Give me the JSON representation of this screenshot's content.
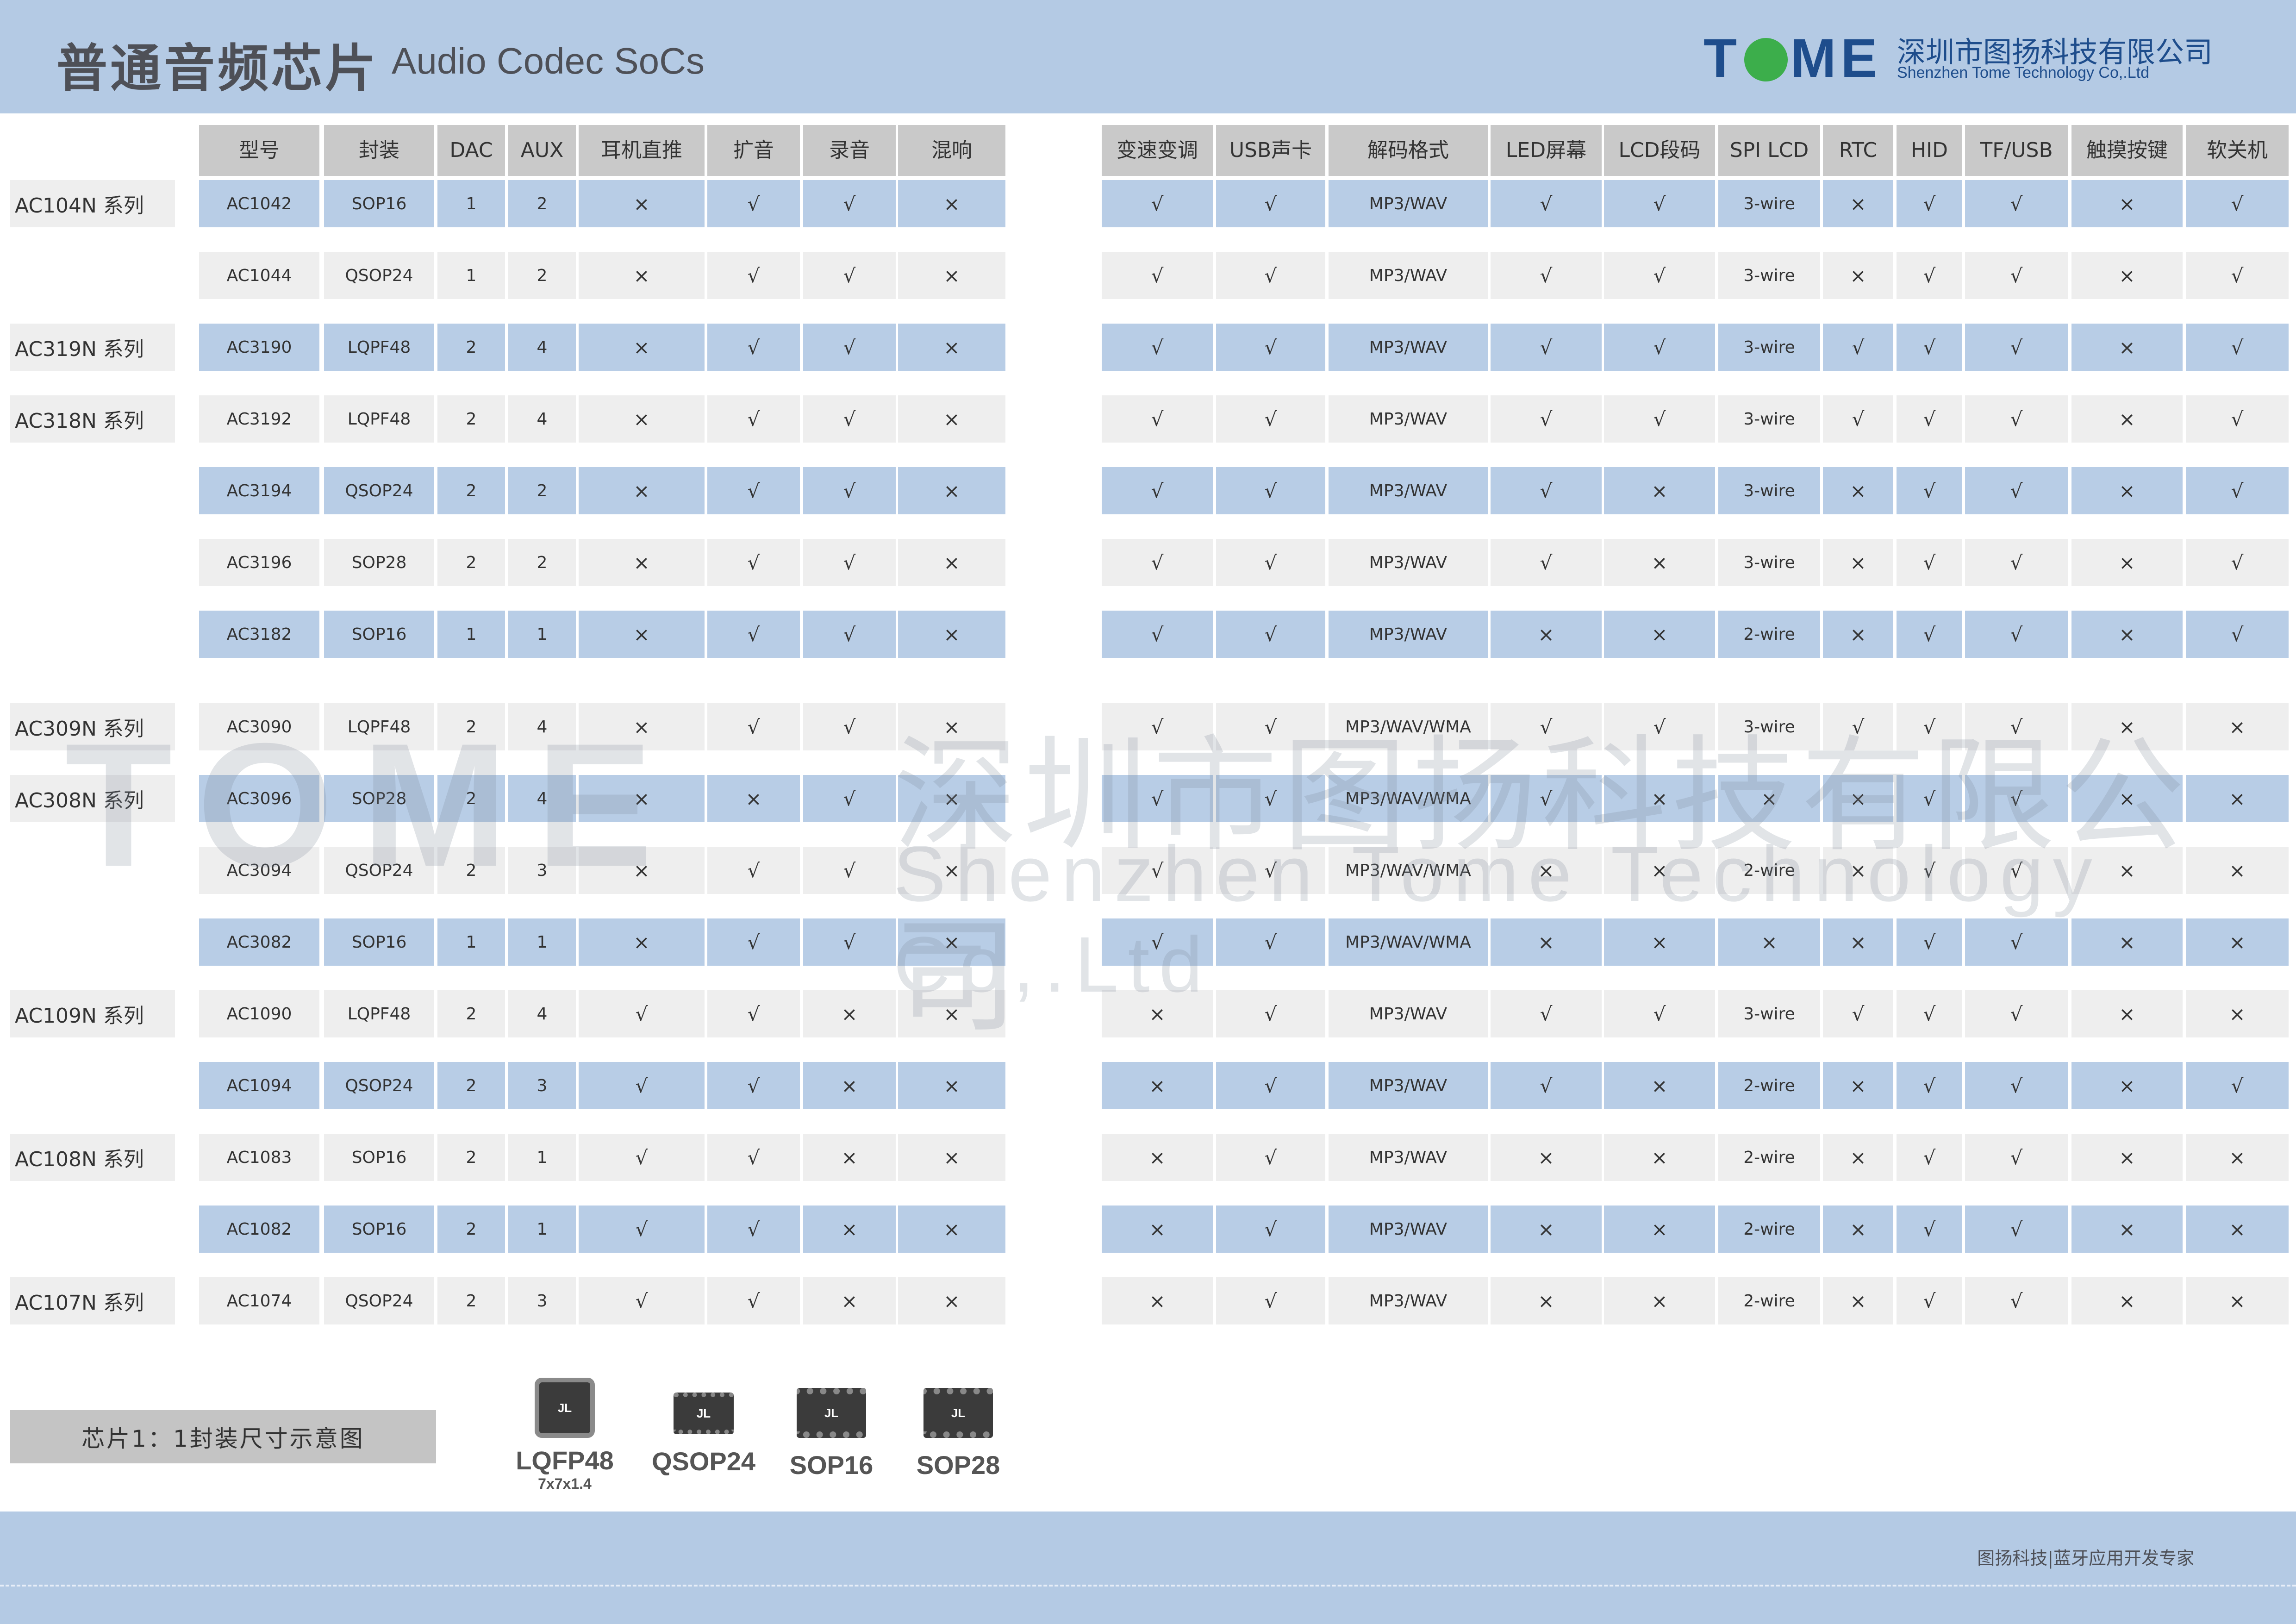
{
  "header": {
    "title_cn": "普通音频芯片",
    "title_en": "Audio Codec SoCs",
    "logo_left": "T",
    "logo_right": "ME",
    "company_cn": "深圳市图扬科技有限公司",
    "company_en": "Shenzhen Tome Technology Co,.Ltd"
  },
  "columns": [
    "型号",
    "封装",
    "DAC",
    "AUX",
    "耳机直推",
    "扩音",
    "录音",
    "混响",
    "变速变调",
    "USB声卡",
    "解码格式",
    "LED屏幕",
    "LCD段码",
    "SPI LCD",
    "RTC",
    "HID",
    "TF/USB",
    "触摸按键",
    "软关机"
  ],
  "series": [
    {
      "label": "AC104N 系列",
      "row": 0
    },
    {
      "label": "AC319N 系列",
      "row": 2
    },
    {
      "label": "AC318N 系列",
      "row": 3
    },
    {
      "label": "AC309N 系列",
      "row": 7
    },
    {
      "label": "AC308N 系列",
      "row": 8
    },
    {
      "label": "AC109N 系列",
      "row": 11
    },
    {
      "label": "AC108N 系列",
      "row": 13
    },
    {
      "label": "AC107N 系列",
      "row": 15
    }
  ],
  "rows": [
    [
      "AC1042",
      "SOP16",
      "1",
      "2",
      "×",
      "√",
      "√",
      "×",
      "√",
      "√",
      "MP3/WAV",
      "√",
      "√",
      "3-wire",
      "×",
      "√",
      "√",
      "×",
      "√"
    ],
    [
      "AC1044",
      "QSOP24",
      "1",
      "2",
      "×",
      "√",
      "√",
      "×",
      "√",
      "√",
      "MP3/WAV",
      "√",
      "√",
      "3-wire",
      "×",
      "√",
      "√",
      "×",
      "√"
    ],
    [
      "AC3190",
      "LQPF48",
      "2",
      "4",
      "×",
      "√",
      "√",
      "×",
      "√",
      "√",
      "MP3/WAV",
      "√",
      "√",
      "3-wire",
      "√",
      "√",
      "√",
      "×",
      "√"
    ],
    [
      "AC3192",
      "LQPF48",
      "2",
      "4",
      "×",
      "√",
      "√",
      "×",
      "√",
      "√",
      "MP3/WAV",
      "√",
      "√",
      "3-wire",
      "√",
      "√",
      "√",
      "×",
      "√"
    ],
    [
      "AC3194",
      "QSOP24",
      "2",
      "2",
      "×",
      "√",
      "√",
      "×",
      "√",
      "√",
      "MP3/WAV",
      "√",
      "×",
      "3-wire",
      "×",
      "√",
      "√",
      "×",
      "√"
    ],
    [
      "AC3196",
      "SOP28",
      "2",
      "2",
      "×",
      "√",
      "√",
      "×",
      "√",
      "√",
      "MP3/WAV",
      "√",
      "×",
      "3-wire",
      "×",
      "√",
      "√",
      "×",
      "√"
    ],
    [
      "AC3182",
      "SOP16",
      "1",
      "1",
      "×",
      "√",
      "√",
      "×",
      "√",
      "√",
      "MP3/WAV",
      "×",
      "×",
      "2-wire",
      "×",
      "√",
      "√",
      "×",
      "√"
    ],
    [
      "AC3090",
      "LQPF48",
      "2",
      "4",
      "×",
      "√",
      "√",
      "×",
      "√",
      "√",
      "MP3/WAV/WMA",
      "√",
      "√",
      "3-wire",
      "√",
      "√",
      "√",
      "×",
      "×"
    ],
    [
      "AC3096",
      "SOP28",
      "2",
      "4",
      "×",
      "×",
      "√",
      "×",
      "√",
      "√",
      "MP3/WAV/WMA",
      "√",
      "×",
      "×",
      "×",
      "√",
      "√",
      "×",
      "×"
    ],
    [
      "AC3094",
      "QSOP24",
      "2",
      "3",
      "×",
      "√",
      "√",
      "×",
      "√",
      "√",
      "MP3/WAV/WMA",
      "×",
      "×",
      "2-wire",
      "×",
      "√",
      "√",
      "×",
      "×"
    ],
    [
      "AC3082",
      "SOP16",
      "1",
      "1",
      "×",
      "√",
      "√",
      "×",
      "√",
      "√",
      "MP3/WAV/WMA",
      "×",
      "×",
      "×",
      "×",
      "√",
      "√",
      "×",
      "×"
    ],
    [
      "AC1090",
      "LQPF48",
      "2",
      "4",
      "√",
      "√",
      "×",
      "×",
      "×",
      "√",
      "MP3/WAV",
      "√",
      "√",
      "3-wire",
      "√",
      "√",
      "√",
      "×",
      "×"
    ],
    [
      "AC1094",
      "QSOP24",
      "2",
      "3",
      "√",
      "√",
      "×",
      "×",
      "×",
      "√",
      "MP3/WAV",
      "√",
      "×",
      "2-wire",
      "×",
      "√",
      "√",
      "×",
      "√"
    ],
    [
      "AC1083",
      "SOP16",
      "2",
      "1",
      "√",
      "√",
      "×",
      "×",
      "×",
      "√",
      "MP3/WAV",
      "×",
      "×",
      "2-wire",
      "×",
      "√",
      "√",
      "×",
      "×"
    ],
    [
      "AC1082",
      "SOP16",
      "2",
      "1",
      "√",
      "√",
      "×",
      "×",
      "×",
      "√",
      "MP3/WAV",
      "×",
      "×",
      "2-wire",
      "×",
      "√",
      "√",
      "×",
      "×"
    ],
    [
      "AC1074",
      "QSOP24",
      "2",
      "3",
      "√",
      "√",
      "×",
      "×",
      "×",
      "√",
      "MP3/WAV",
      "×",
      "×",
      "2-wire",
      "×",
      "√",
      "√",
      "×",
      "×"
    ]
  ],
  "watermark": {
    "logo": "TOME",
    "cn": "深圳市图扬科技有限公司",
    "en": "Shenzhen Tome Technology Co,.Ltd"
  },
  "legend_label": "芯片1：1封装尺寸示意图",
  "packages": [
    {
      "name": "LQFP48",
      "sub": "7x7x1.4",
      "chip_label": "JL"
    },
    {
      "name": "QSOP24",
      "sub": "",
      "chip_label": "JL"
    },
    {
      "name": "SOP16",
      "sub": "",
      "chip_label": "JL"
    },
    {
      "name": "SOP28",
      "sub": "",
      "chip_label": "JL"
    }
  ],
  "footer_text": "图扬科技|蓝牙应用开发专家",
  "colors": {
    "header_bg": "#b4cae4",
    "row_blue": "#b8cde6",
    "row_gray": "#eeeeee",
    "header_cell": "#c9c9c9",
    "brand": "#1e4d8c",
    "logo_green": "#3cae4b"
  }
}
